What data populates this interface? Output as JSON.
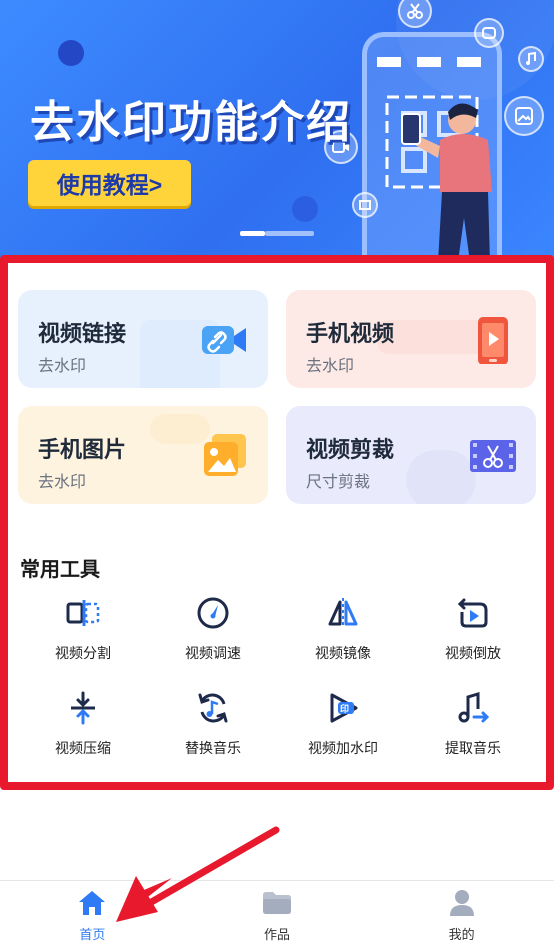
{
  "banner": {
    "title": "去水印功能介绍",
    "tutorial_button": "使用教程>"
  },
  "cards": [
    {
      "title": "视频链接",
      "subtitle": "去水印",
      "icon": "link-camera-icon"
    },
    {
      "title": "手机视频",
      "subtitle": "去水印",
      "icon": "phone-play-icon"
    },
    {
      "title": "手机图片",
      "subtitle": "去水印",
      "icon": "image-icon"
    },
    {
      "title": "视频剪裁",
      "subtitle": "尺寸剪裁",
      "icon": "scissors-film-icon"
    }
  ],
  "tools_section": {
    "title": "常用工具",
    "items": [
      {
        "label": "视频分割",
        "icon": "split-icon"
      },
      {
        "label": "视频调速",
        "icon": "speed-icon"
      },
      {
        "label": "视频镜像",
        "icon": "mirror-icon"
      },
      {
        "label": "视频倒放",
        "icon": "reverse-icon"
      },
      {
        "label": "视频压缩",
        "icon": "compress-icon"
      },
      {
        "label": "替换音乐",
        "icon": "replace-music-icon"
      },
      {
        "label": "视频加水印",
        "icon": "add-watermark-icon"
      },
      {
        "label": "提取音乐",
        "icon": "extract-music-icon"
      }
    ]
  },
  "bottom_nav": {
    "items": [
      {
        "label": "首页",
        "icon": "home-icon",
        "active": true
      },
      {
        "label": "作品",
        "icon": "folder-icon",
        "active": false
      },
      {
        "label": "我的",
        "icon": "user-icon",
        "active": false
      }
    ]
  },
  "colors": {
    "accent": "#2f6ff0",
    "highlight_border": "#e8192c",
    "tutorial_button_bg": "#ffd43a",
    "icon_dark": "#1e2a4a",
    "icon_blue": "#2f7bf5"
  }
}
